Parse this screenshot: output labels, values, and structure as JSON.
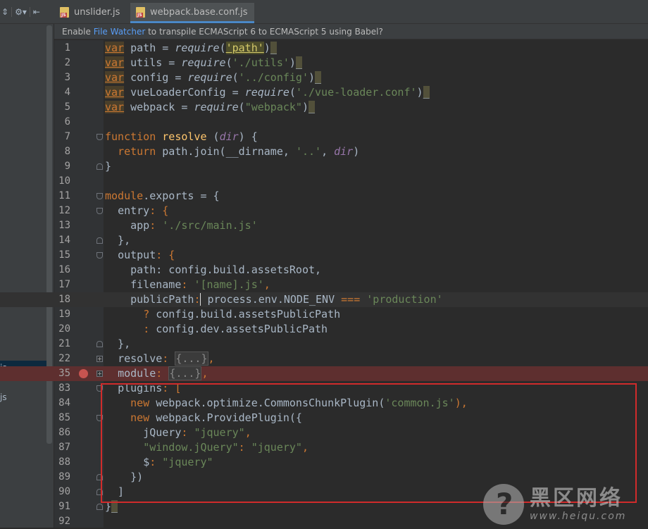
{
  "left_panel": {
    "toolbar_icons": [
      "collapse-icon",
      "gear-icon",
      "hide-icon"
    ],
    "items": [
      {
        "label": "js",
        "selected": true
      },
      {
        "label": "",
        "selected": false
      },
      {
        "label": "js",
        "selected": false
      }
    ]
  },
  "tabs": [
    {
      "label": "unslider.js",
      "close": "×",
      "active": false
    },
    {
      "label": "webpack.base.conf.js",
      "close": "×",
      "active": true
    }
  ],
  "banner": {
    "prefix": "Enable ",
    "link": "File Watcher",
    "suffix": " to transpile ECMAScript 6 to ECMAScript 5 using Babel?"
  },
  "line_numbers": [
    "1",
    "2",
    "3",
    "4",
    "5",
    "6",
    "7",
    "8",
    "9",
    "10",
    "11",
    "12",
    "13",
    "14",
    "15",
    "16",
    "17",
    "18",
    "19",
    "20",
    "21",
    "22",
    "35",
    "83",
    "84",
    "85",
    "86",
    "87",
    "88",
    "89",
    "90",
    "91",
    "92"
  ],
  "code": {
    "l1": {
      "kw": "var",
      "rest1": " path = ",
      "req": "require",
      "p1": "(",
      "s": "'path'",
      "p2": ")",
      "tail": "_"
    },
    "l2": {
      "kw": "var",
      "rest1": " utils = ",
      "req": "require",
      "p1": "(",
      "s": "'./utils'",
      "p2": ")",
      "tail": "_"
    },
    "l3": {
      "kw": "var",
      "rest1": " config = ",
      "req": "require",
      "p1": "(",
      "s": "'../config'",
      "p2": ")",
      "tail": "_"
    },
    "l4": {
      "kw": "var",
      "rest1": " vueLoaderConfig = ",
      "req": "require",
      "p1": "(",
      "s": "'./vue-loader.conf'",
      "p2": ")",
      "tail": "_"
    },
    "l5": {
      "kw": "var",
      "rest1": " webpack = ",
      "req": "require",
      "p1": "(",
      "s": "\"webpack\"",
      "p2": ")",
      "tail": "_"
    },
    "l7": {
      "kw": "function",
      "sp": " ",
      "fn": "resolve",
      "p1": " (",
      "par": "dir",
      "p2": ") {"
    },
    "l8": {
      "indent": "  ",
      "kw": "return",
      "mid": " path.join(__dirname, ",
      "s": "'..'",
      "comma": ", ",
      "par": "dir",
      "end": ")"
    },
    "l9": {
      "text": "}"
    },
    "l11": {
      "a": "module",
      "b": ".exports = {"
    },
    "l12": {
      "indent": "  ",
      "k": "entry",
      "c": ": {"
    },
    "l13": {
      "indent": "    ",
      "k": "app",
      "c": ": ",
      "s": "'./src/main.js'"
    },
    "l14": {
      "text": "  },"
    },
    "l15": {
      "indent": "  ",
      "k": "output",
      "c": ": {"
    },
    "l16": {
      "indent": "    ",
      "k": "path",
      "c": ": config.build.assetsRoot,"
    },
    "l17": {
      "indent": "    ",
      "k": "filename",
      "c": ": ",
      "s": "'[name].js'",
      "e": ","
    },
    "l18": {
      "indent": "    ",
      "k": "publicPath",
      "c": ":",
      "rest": " process.env.NODE_ENV ",
      "op": "===",
      "sp": " ",
      "s": "'production'"
    },
    "l19": {
      "indent": "      ",
      "q": "?",
      "rest": " config.build.assetsPublicPath"
    },
    "l20": {
      "indent": "      ",
      "q": ":",
      "rest": " config.dev.assetsPublicPath"
    },
    "l21": {
      "text": "  },"
    },
    "l22": {
      "indent": "  ",
      "k": "resolve",
      "c": ": ",
      "fold": "{...}",
      "e": ","
    },
    "l35": {
      "indent": "  ",
      "k": "module",
      "c": ": ",
      "fold": "{...}",
      "e": ","
    },
    "l83": {
      "indent": "  ",
      "k": "plugins",
      "c": ": ["
    },
    "l84": {
      "indent": "    ",
      "kw": "new",
      "mid": " webpack.optimize.CommonsChunkPlugin(",
      "s": "'common.js'",
      "e": "),"
    },
    "l85": {
      "indent": "    ",
      "kw": "new",
      "mid": " webpack.ProvidePlugin({"
    },
    "l86": {
      "indent": "      ",
      "k": "jQuery",
      "c": ": ",
      "s": "\"jquery\"",
      "e": ","
    },
    "l87": {
      "indent": "      ",
      "s1": "\"window.jQuery\"",
      "c": ": ",
      "s": "\"jquery\"",
      "e": ","
    },
    "l88": {
      "indent": "      ",
      "k": "$",
      "c": ": ",
      "s": "\"jquery\""
    },
    "l89": {
      "text": "    })"
    },
    "l90": {
      "text": "  ]"
    },
    "l91": {
      "a": "}",
      "tail": "_"
    }
  },
  "watermark": {
    "cn": "黑区网络",
    "url": "www.heiqu.com"
  },
  "colors": {
    "background": "#2b2b2b",
    "keyword": "#cc7832",
    "string": "#6a8759",
    "function": "#ffc66d",
    "param": "#9876aa",
    "text": "#a9b7c6",
    "highlight_box": "#d02b2b",
    "breakpoint": "#c75450"
  }
}
